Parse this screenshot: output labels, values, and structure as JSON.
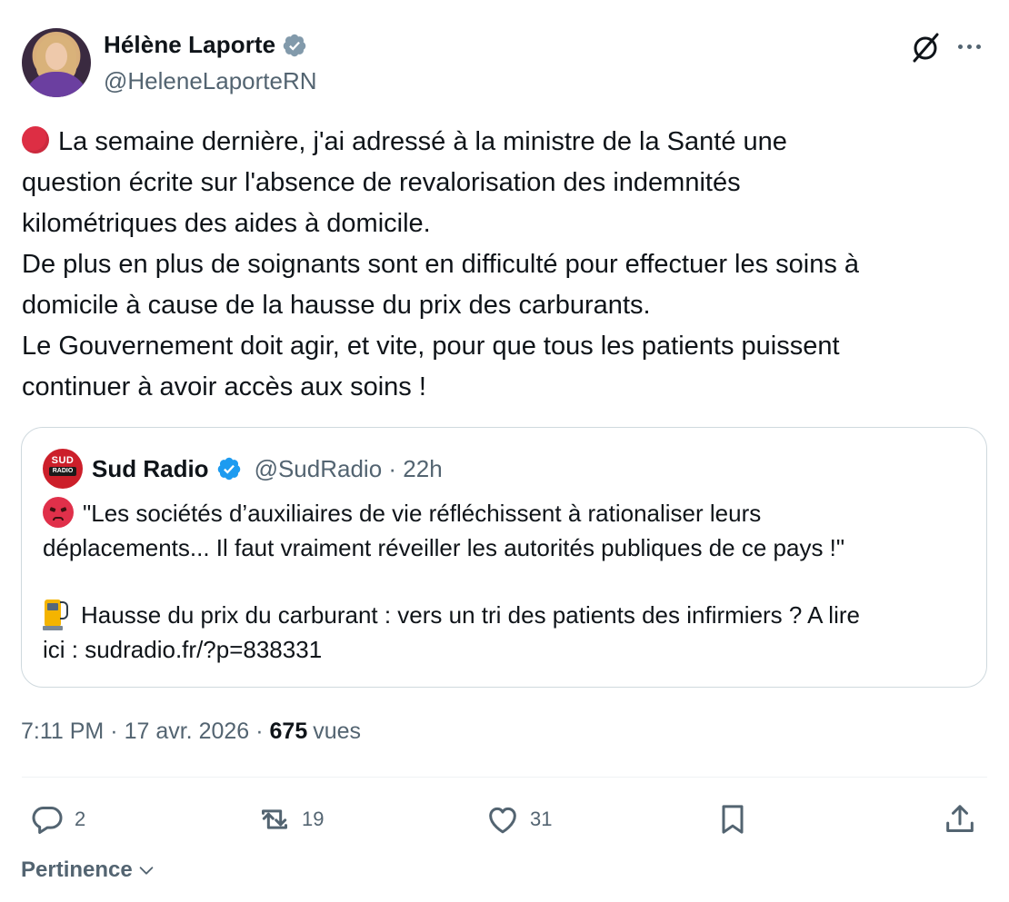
{
  "author": {
    "name": "Hélène Laporte",
    "handle": "@HeleneLaporteRN"
  },
  "tweet": {
    "lines": [
      "La semaine dernière, j'ai adressé à la ministre de la Santé une",
      "question écrite sur l'absence de revalorisation des indemnités",
      "kilométriques des aides à domicile.",
      "De plus en plus de soignants sont en difficulté pour effectuer les soins à",
      "domicile à cause de la hausse du prix des carburants.",
      "Le Gouvernement doit agir, et vite, pour que tous les patients puissent",
      "continuer à avoir accès aux soins !"
    ]
  },
  "quote": {
    "avatar_top": "SUD",
    "avatar_mid": "RADIO",
    "name": "Sud Radio",
    "handle": "@SudRadio",
    "separator": "·",
    "time": "22h",
    "lines1": [
      "\"Les sociétés d’auxiliaires de vie réfléchissent à rationaliser leurs",
      "déplacements... Il faut vraiment réveiller les autorités publiques de ce pays !\""
    ],
    "lines2": [
      "Hausse du prix du carburant : vers un tri des patients des infirmiers ? A lire",
      "ici : sudradio.fr/?p=838331"
    ]
  },
  "meta": {
    "time": "7:11 PM",
    "sep1": "·",
    "date": "17 avr. 2026",
    "sep2": "·",
    "views_count": "675",
    "views_label": "vues"
  },
  "actions": {
    "replies": "2",
    "reposts": "19",
    "likes": "31"
  },
  "sort": {
    "label": "Pertinence"
  },
  "colors": {
    "verified": "#1d9bf0",
    "text": "#0f1419",
    "secondary": "#536471",
    "border": "#cfd9de"
  }
}
